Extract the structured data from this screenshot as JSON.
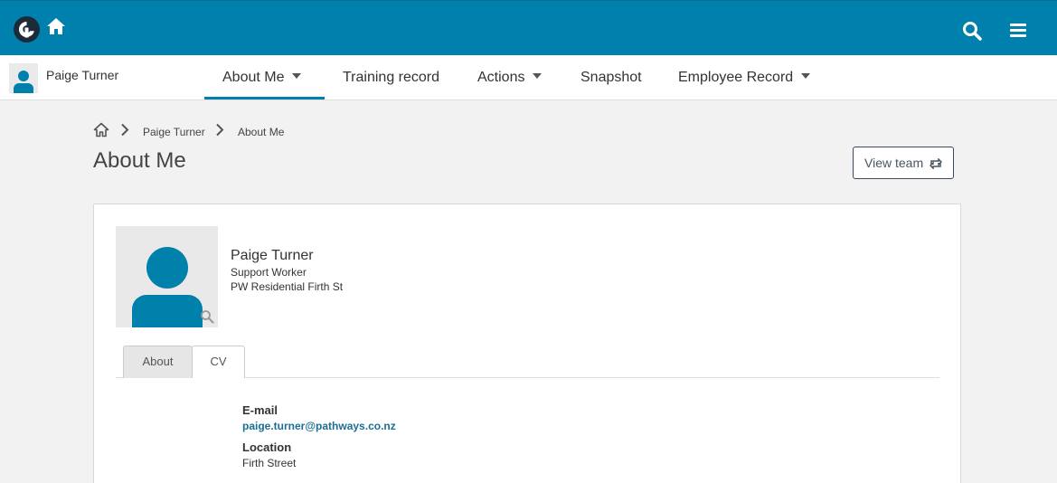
{
  "topbar": {
    "logo_icon": "pathways-logo-icon",
    "home_icon": "home-icon",
    "search_icon": "search-icon",
    "menu_icon": "hamburger-menu-icon",
    "brand_color": "#0080ad"
  },
  "navbar": {
    "user_name": "Paige Turner",
    "tabs": [
      {
        "label": "About Me",
        "has_dropdown": true,
        "active": true
      },
      {
        "label": "Training record",
        "has_dropdown": false
      },
      {
        "label": "Actions",
        "has_dropdown": true
      },
      {
        "label": "Snapshot",
        "has_dropdown": false
      },
      {
        "label": "Employee Record",
        "has_dropdown": true
      }
    ]
  },
  "breadcrumb": {
    "home_icon": "home-outline-icon",
    "items": [
      "Paige Turner",
      "About Me"
    ]
  },
  "page": {
    "title": "About Me",
    "view_team_label": "View team"
  },
  "profile": {
    "name": "Paige Turner",
    "role": "Support Worker",
    "site": "PW Residential Firth St"
  },
  "profile_tabs": [
    "About",
    "CV"
  ],
  "about": {
    "email_label": "E-mail",
    "email_value": "paige.turner@pathways.co.nz",
    "location_label": "Location",
    "location_value": "Firth Street"
  }
}
